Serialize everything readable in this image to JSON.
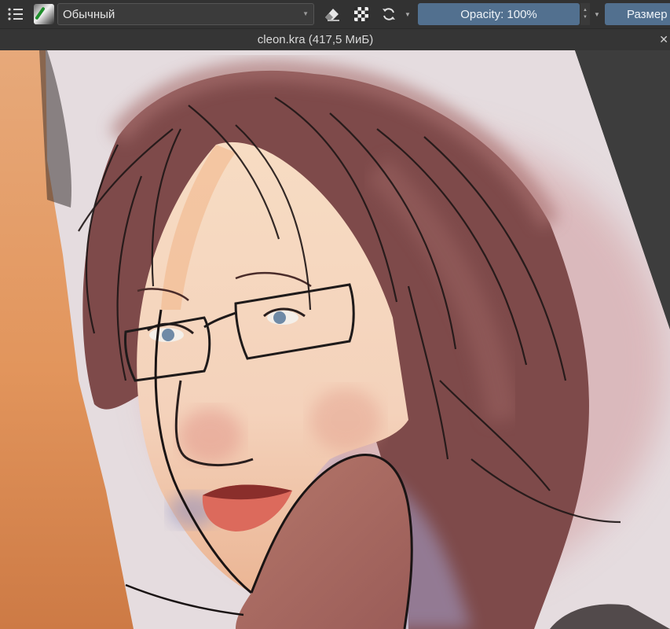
{
  "toolbar": {
    "options_icon": "brush-options-icon",
    "preset_icon": "brush-preset-icon",
    "blend_mode": "Обычный",
    "eraser_icon": "eraser-icon",
    "alpha_icon": "preserve-alpha-icon",
    "reload_icon": "reload-preset-icon",
    "opacity_label": "Opacity: 100%",
    "size_label": "Размер"
  },
  "document": {
    "title": "cleon.kra (417,5 МиБ)",
    "close_icon": "close-icon"
  },
  "colors": {
    "toolbar_bg": "#323232",
    "slider_accent": "#52708f",
    "canvas_bg": "#404040",
    "paper": "#e4dadd"
  }
}
